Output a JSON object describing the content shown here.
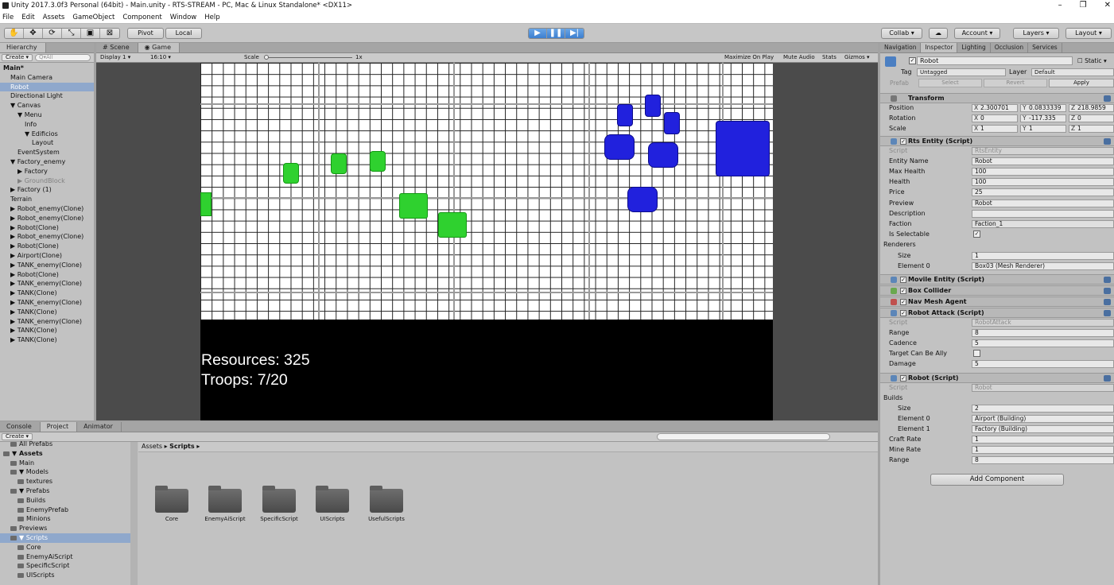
{
  "window": {
    "title": "Unity 2017.3.0f3 Personal (64bit) - Main.unity - RTS-STREAM - PC, Mac & Linux Standalone* <DX11>",
    "min": "–",
    "max": "❐",
    "close": "✕"
  },
  "menu": [
    "File",
    "Edit",
    "Assets",
    "GameObject",
    "Component",
    "Window",
    "Help"
  ],
  "toolbar": {
    "pivot": "Pivot",
    "local": "Local",
    "collab": "Collab ▾",
    "account": "Account ▾",
    "layers": "Layers ▾",
    "layout": "Layout ▾",
    "play": "▶",
    "pause": "❚❚",
    "step": "▶|"
  },
  "hierarchy": {
    "tab": "Hierarchy",
    "create": "Create ▾",
    "search": "Q▾All",
    "items": [
      {
        "label": "Main*",
        "indent": 0,
        "bold": true
      },
      {
        "label": "Main Camera",
        "indent": 1
      },
      {
        "label": "Robot",
        "indent": 1,
        "selected": true
      },
      {
        "label": "Directional Light",
        "indent": 1
      },
      {
        "label": "▼ Canvas",
        "indent": 1
      },
      {
        "label": "▼ Menu",
        "indent": 2
      },
      {
        "label": "Info",
        "indent": 3
      },
      {
        "label": "▼ Edificios",
        "indent": 3
      },
      {
        "label": "Layout",
        "indent": 4
      },
      {
        "label": "EventSystem",
        "indent": 2
      },
      {
        "label": "▼ Factory_enemy",
        "indent": 1
      },
      {
        "label": "▶ Factory",
        "indent": 2
      },
      {
        "label": "▶ GroundBlock",
        "indent": 2,
        "gray": true
      },
      {
        "label": "▶ Factory (1)",
        "indent": 1
      },
      {
        "label": "Terrain",
        "indent": 1
      },
      {
        "label": "▶ Robot_enemy(Clone)",
        "indent": 1
      },
      {
        "label": "▶ Robot_enemy(Clone)",
        "indent": 1
      },
      {
        "label": "▶ Robot(Clone)",
        "indent": 1
      },
      {
        "label": "▶ Robot_enemy(Clone)",
        "indent": 1
      },
      {
        "label": "▶ Robot(Clone)",
        "indent": 1
      },
      {
        "label": "▶ Airport(Clone)",
        "indent": 1
      },
      {
        "label": "▶ TANK_enemy(Clone)",
        "indent": 1
      },
      {
        "label": "▶ Robot(Clone)",
        "indent": 1
      },
      {
        "label": "▶ TANK_enemy(Clone)",
        "indent": 1
      },
      {
        "label": "▶ TANK(Clone)",
        "indent": 1
      },
      {
        "label": "▶ TANK_enemy(Clone)",
        "indent": 1
      },
      {
        "label": "▶ TANK(Clone)",
        "indent": 1
      },
      {
        "label": "▶ TANK_enemy(Clone)",
        "indent": 1
      },
      {
        "label": "▶ TANK(Clone)",
        "indent": 1
      },
      {
        "label": "▶ TANK(Clone)",
        "indent": 1
      }
    ]
  },
  "view": {
    "tab_scene": "Scene",
    "tab_game": "Game",
    "display": "Display 1 ▾",
    "aspect": "16:10 ▾",
    "scale_label": "Scale",
    "scale_value": "1x",
    "maximize": "Maximize On Play",
    "mute": "Mute Audio",
    "stats": "Stats",
    "gizmos": "Gizmos ▾"
  },
  "hud": {
    "resources": "Resources: 325",
    "troops": "Troops: 7/20"
  },
  "inspector": {
    "tabs": [
      "Navigation",
      "Inspector",
      "Lighting",
      "Occlusion",
      "Services"
    ],
    "name": "Robot",
    "static": "Static ▾",
    "tag_label": "Tag",
    "tag": "Untagged",
    "layer_label": "Layer",
    "layer": "Default",
    "prefab": "Prefab",
    "select": "Select",
    "revert": "Revert",
    "apply": "Apply",
    "transform": {
      "title": "Transform",
      "position": "Position",
      "rotation": "Rotation",
      "scale": "Scale",
      "px": "2.300701",
      "py": "0.0833339",
      "pz": "218.9859",
      "rx": "0",
      "ry": "-117.335",
      "rz": "0",
      "sx": "1",
      "sy": "1",
      "sz": "1"
    },
    "rts": {
      "title": "Rts Entity (Script)",
      "script_l": "Script",
      "script": "RtsEntity",
      "name_l": "Entity Name",
      "name": "Robot",
      "maxh_l": "Max Health",
      "maxh": "100",
      "health_l": "Health",
      "health": "100",
      "price_l": "Price",
      "price": "25",
      "preview_l": "Preview",
      "preview": "Robot",
      "desc_l": "Description",
      "desc": "",
      "faction_l": "Faction",
      "faction": "Faction_1",
      "selectable_l": "Is Selectable",
      "selectable": "✓",
      "renderers_l": "Renderers",
      "size_l": "Size",
      "size": "1",
      "el0_l": "Element 0",
      "el0": "Box03 (Mesh Renderer)"
    },
    "components": [
      "Movile Entity (Script)",
      "Box Collider",
      "Nav Mesh Agent"
    ],
    "attack": {
      "title": "Robot Attack (Script)",
      "script_l": "Script",
      "script": "RobotAttack",
      "range_l": "Range",
      "range": "8",
      "cadence_l": "Cadence",
      "cadence": "5",
      "ally_l": "Target Can Be Ally",
      "damage_l": "Damage",
      "damage": "5"
    },
    "robot": {
      "title": "Robot (Script)",
      "script_l": "Script",
      "script": "Robot",
      "builds_l": "Builds",
      "size_l": "Size",
      "size": "2",
      "el0_l": "Element 0",
      "el0": "Airport (Building)",
      "el1_l": "Element 1",
      "el1": "Factory (Building)",
      "craft_l": "Craft Rate",
      "craft": "1",
      "mine_l": "Mine Rate",
      "mine": "1",
      "range_l": "Range",
      "range": "8"
    },
    "add_component": "Add Component"
  },
  "project": {
    "tabs": [
      "Console",
      "Project",
      "Animator"
    ],
    "create": "Create ▾",
    "breadcrumb_root": "Assets ▸",
    "breadcrumb_cur": "Scripts ▸",
    "tree": [
      {
        "label": "All Prefabs",
        "indent": 1
      },
      {
        "label": "▼ Assets",
        "indent": 0,
        "bold": true
      },
      {
        "label": "Main",
        "indent": 1
      },
      {
        "label": "▼ Models",
        "indent": 1
      },
      {
        "label": "textures",
        "indent": 2
      },
      {
        "label": "▼ Prefabs",
        "indent": 1
      },
      {
        "label": "Builds",
        "indent": 2
      },
      {
        "label": "EnemyPrefab",
        "indent": 2
      },
      {
        "label": "Minions",
        "indent": 2
      },
      {
        "label": "Previews",
        "indent": 1
      },
      {
        "label": "▼ Scripts",
        "indent": 1,
        "selected": true
      },
      {
        "label": "Core",
        "indent": 2
      },
      {
        "label": "EnemyAiScript",
        "indent": 2
      },
      {
        "label": "SpecificScript",
        "indent": 2
      },
      {
        "label": "UIScripts",
        "indent": 2
      }
    ],
    "folders": [
      "Core",
      "EnemyAiScript",
      "SpecificScript",
      "UIScripts",
      "UsefulScripts"
    ]
  }
}
